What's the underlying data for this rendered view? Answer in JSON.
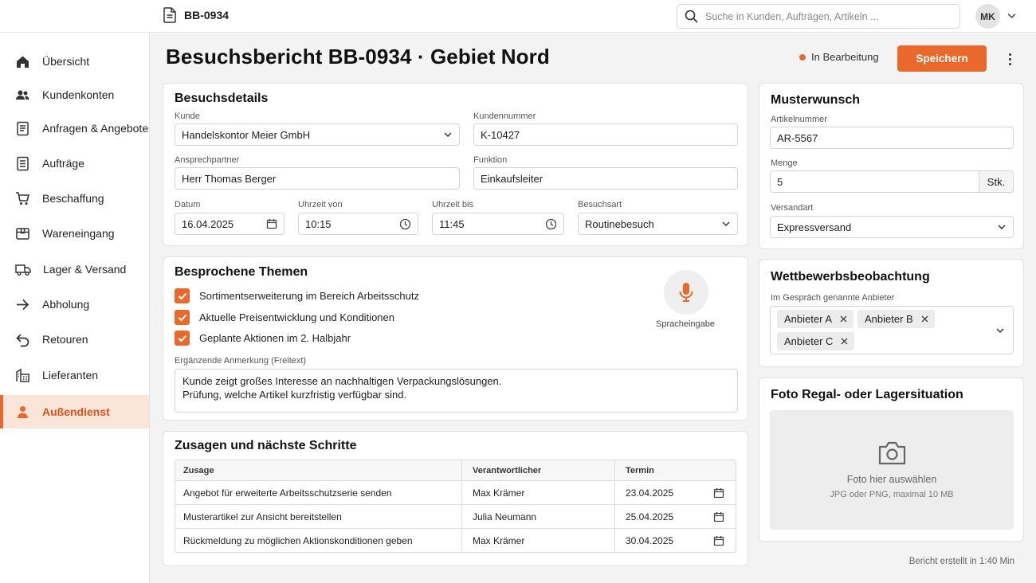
{
  "topbar": {
    "doc_id": "BB-0934",
    "search_placeholder": "Suche in Kunden, Aufträgen, Artikeln ...",
    "user_initials": "MK"
  },
  "sidebar": {
    "items": [
      {
        "label": "Übersicht",
        "icon": "home-icon"
      },
      {
        "label": "Kundenkonten",
        "icon": "users-icon"
      },
      {
        "label": "Anfragen & Angebote",
        "icon": "document-icon"
      },
      {
        "label": "Aufträge",
        "icon": "list-document-icon"
      },
      {
        "label": "Beschaffung",
        "icon": "cart-icon"
      },
      {
        "label": "Wareneingang",
        "icon": "box-icon"
      },
      {
        "label": "Lager & Versand",
        "icon": "truck-icon"
      },
      {
        "label": "Abholung",
        "icon": "arrow-right-icon"
      },
      {
        "label": "Retouren",
        "icon": "return-icon"
      },
      {
        "label": "Lieferanten",
        "icon": "building-icon"
      },
      {
        "label": "Außendienst",
        "icon": "person-icon",
        "active": true
      }
    ]
  },
  "header": {
    "title": "Besuchsbericht BB-0934 · Gebiet Nord",
    "status": "In Bearbeitung",
    "save_label": "Speichern"
  },
  "details": {
    "title": "Besuchsdetails",
    "customer_label": "Kunde",
    "customer_value": "Handelskontor Meier GmbH",
    "customer_no_label": "Kundennummer",
    "customer_no_value": "K-10427",
    "contact_label": "Ansprechpartner",
    "contact_value": "Herr Thomas Berger",
    "function_label": "Funktion",
    "function_value": "Einkaufsleiter",
    "date_label": "Datum",
    "date_value": "16.04.2025",
    "time_from_label": "Uhrzeit von",
    "time_from_value": "10:15",
    "time_to_label": "Uhrzeit bis",
    "time_to_value": "11:45",
    "visit_type_label": "Besuchsart",
    "visit_type_value": "Routinebesuch"
  },
  "topics": {
    "title": "Besprochene Themen",
    "items": [
      "Sortimentserweiterung im Bereich Arbeitsschutz",
      "Aktuelle Preisentwicklung und Konditionen",
      "Geplante Aktionen im 2. Halbjahr"
    ],
    "voice_label": "Spracheingabe",
    "note_label": "Ergänzende Anmerkung (Freitext)",
    "note_line1": "Kunde zeigt großes Interesse an nachhaltigen Verpackungslösungen.",
    "note_line2": "Prüfung, welche Artikel kurzfristig verfügbar sind."
  },
  "commitments": {
    "title": "Zusagen und nächste Schritte",
    "headers": [
      "Zusage",
      "Verantwortlicher",
      "Termin"
    ],
    "rows": [
      [
        "Angebot für erweiterte Arbeitsschutzserie senden",
        "Max Krämer",
        "23.04.2025"
      ],
      [
        "Musterartikel zur Ansicht bereitstellen",
        "Julia Neumann",
        "25.04.2025"
      ],
      [
        "Rückmeldung zu möglichen Aktionskonditionen geben",
        "Max Krämer",
        "30.04.2025"
      ]
    ]
  },
  "sample": {
    "title": "Musterwunsch",
    "article_label": "Artikelnummer",
    "article_value": "AR-5567",
    "qty_label": "Menge",
    "qty_value": "5",
    "qty_unit": "Stk.",
    "shipping_label": "Versandart",
    "shipping_value": "Expressversand"
  },
  "competition": {
    "title": "Wettbewerbsbeobachtung",
    "label": "Im Gespräch genannte Anbieter",
    "chips": [
      "Anbieter A",
      "Anbieter B",
      "Anbieter C"
    ]
  },
  "photo": {
    "title": "Foto Regal- oder Lagersituation",
    "cta": "Foto hier auswählen",
    "hint": "JPG oder PNG, maximal 10 MB"
  },
  "footer": {
    "note": "Bericht erstellt in 1:40 Min"
  },
  "colors": {
    "accent": "#e8692b",
    "active_bg": "#fbe5d9"
  }
}
